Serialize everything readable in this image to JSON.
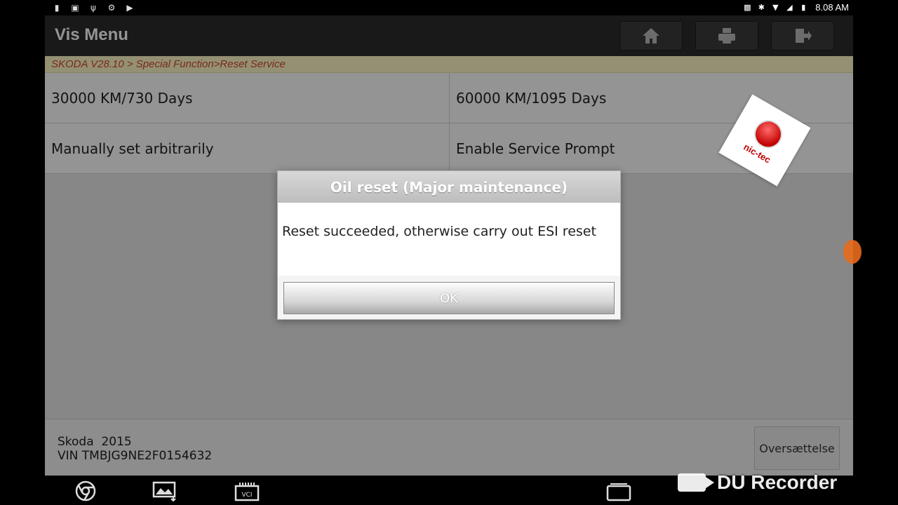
{
  "statusbar": {
    "clock": "8.08 AM",
    "left_icons": [
      "video-icon",
      "gallery-icon",
      "usb-icon",
      "debug-icon",
      "play-store-icon"
    ],
    "right_icons": [
      "cast-icon",
      "bluetooth-icon",
      "wifi-icon",
      "signal-icon",
      "battery-icon"
    ]
  },
  "header": {
    "title": "Vis Menu",
    "buttons": [
      "home-icon",
      "print-icon",
      "exit-icon"
    ]
  },
  "breadcrumb": "SKODA V28.10 > Special Function>Reset Service",
  "menu": {
    "items": [
      {
        "label": "30000 KM/730 Days"
      },
      {
        "label": "60000 KM/1095 Days"
      },
      {
        "label": "Manually set arbitrarily"
      },
      {
        "label": "Enable Service Prompt"
      }
    ]
  },
  "dialog": {
    "title": "Oil reset (Major maintenance)",
    "message": "Reset succeeded, otherwise carry out ESI reset",
    "ok_label": "OK"
  },
  "footer": {
    "vehicle": "Skoda  2015",
    "vin": "VIN TMBJG9NE2F0154632",
    "translate_label": "Oversættelse"
  },
  "watermarks": {
    "logo_text": "nic-tec",
    "recorder_text": "DU Recorder"
  },
  "navbar": {
    "vci_label": "VCI",
    "icons": [
      "browser-icon",
      "screenshot-icon",
      "vci-icon",
      "recent-apps-icon"
    ]
  },
  "colors": {
    "header_bg": "#2b2b2b",
    "breadcrumb_bg": "#fff8c8",
    "breadcrumb_text": "#d04a2a",
    "logo_red": "#c00000"
  }
}
